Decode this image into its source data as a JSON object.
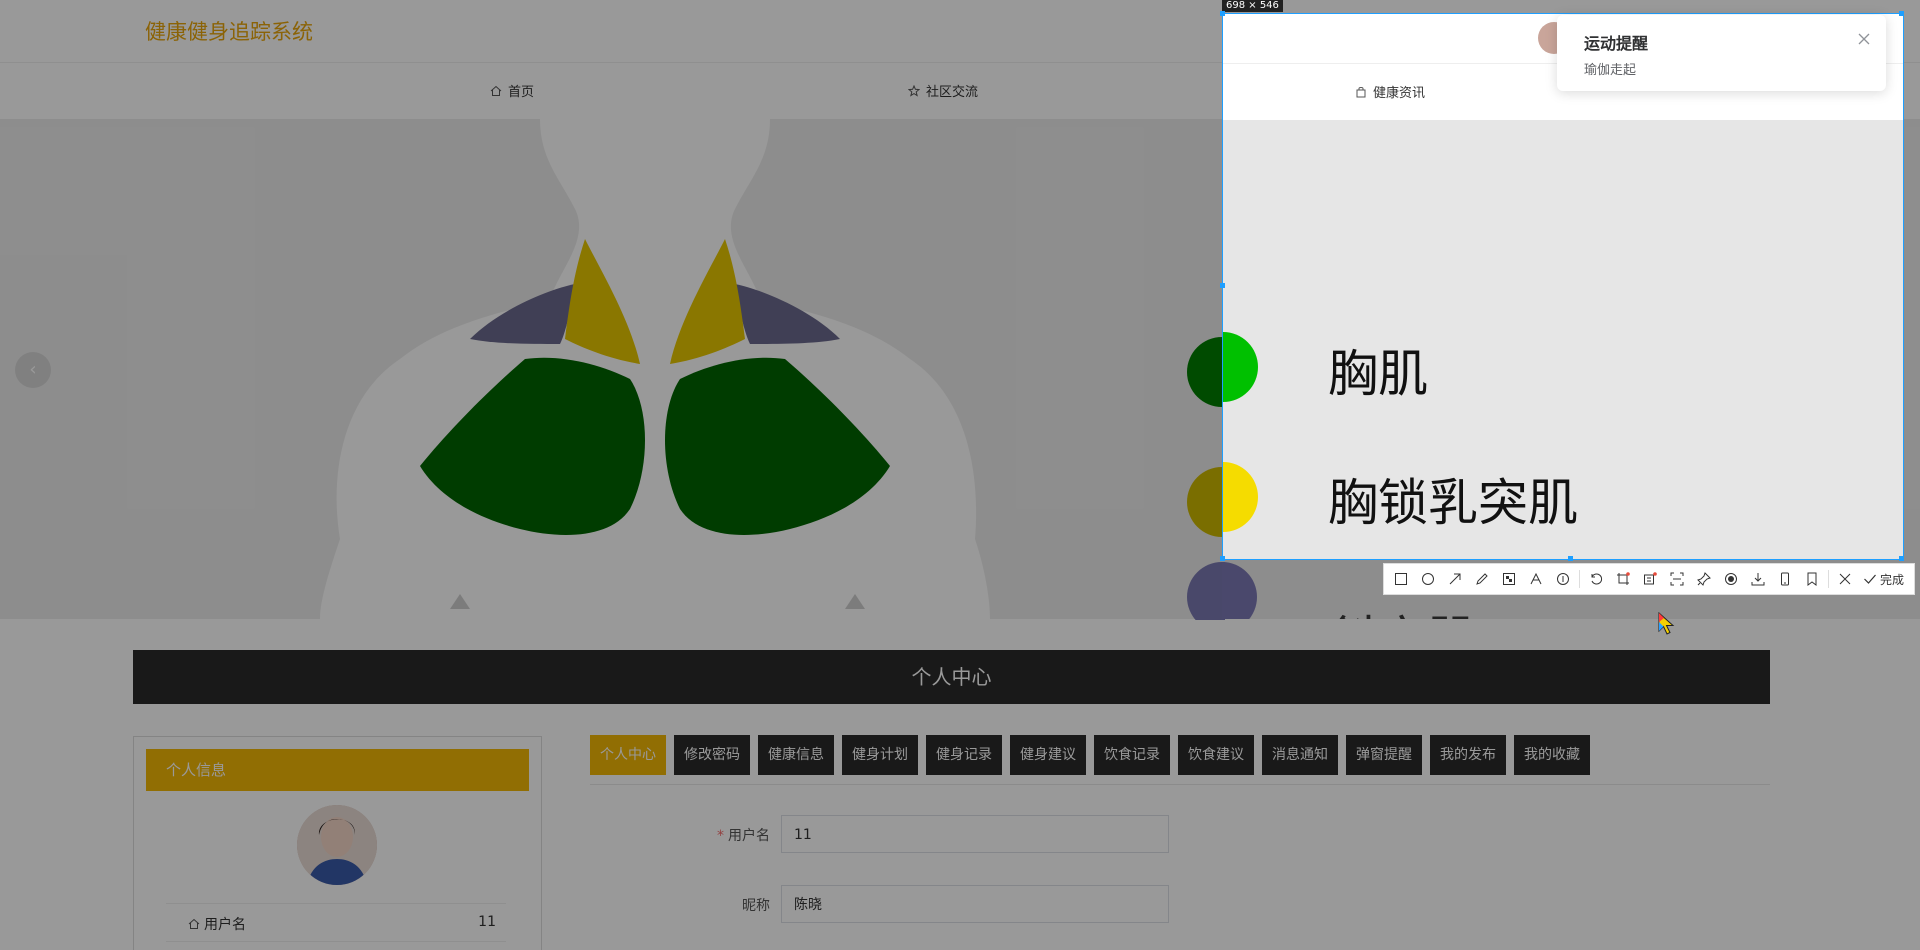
{
  "app": {
    "title": "健康健身追踪系统"
  },
  "nav": {
    "home": "首页",
    "community": "社区交流",
    "health_news": "健康资讯"
  },
  "banner": {
    "legend": [
      "胸肌",
      "胸锁乳突肌",
      "斜方肌"
    ]
  },
  "capture": {
    "size_label": "698 × 546"
  },
  "personal_center": {
    "title": "个人中心",
    "panel_title": "个人信息",
    "info": [
      {
        "label": "用户名",
        "value": "11"
      },
      {
        "label": "昵称",
        "value": "陈晓"
      }
    ],
    "tabs": [
      "个人中心",
      "修改密码",
      "健康信息",
      "健身计划",
      "健身记录",
      "健身建议",
      "饮食记录",
      "饮食建议",
      "消息通知",
      "弹窗提醒",
      "我的发布",
      "我的收藏"
    ],
    "form": {
      "username_label": "用户名",
      "username_value": "11",
      "nickname_label": "昵称",
      "nickname_value": "陈晓"
    }
  },
  "notification": {
    "title": "运动提醒",
    "message": "瑜伽走起"
  },
  "toolbar": {
    "done_label": "完成"
  },
  "colors": {
    "accent": "#f2b705",
    "logo": "#e8a60c",
    "dark": "#2b2b2b",
    "capture_border": "#1e9fff",
    "pec_green": "#006400",
    "light_green": "#00c000",
    "yellow": "#f5dc00",
    "purple": "#6c6a8e"
  }
}
